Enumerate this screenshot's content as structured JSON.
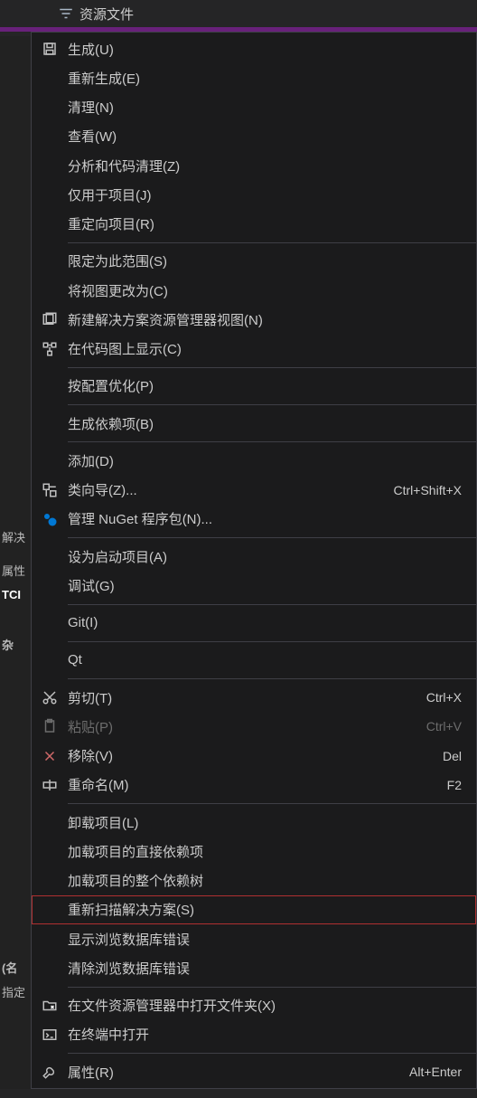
{
  "tree": {
    "item_label": "资源文件"
  },
  "leftPanel": {
    "label1": "解决",
    "label2": "属性",
    "label3": "TCI",
    "label4": "杂",
    "label5": "(名",
    "label6": "指定"
  },
  "menu": [
    {
      "type": "item",
      "icon": "save-icon",
      "label": "生成(U)"
    },
    {
      "type": "item",
      "icon": null,
      "label": "重新生成(E)"
    },
    {
      "type": "item",
      "icon": null,
      "label": "清理(N)"
    },
    {
      "type": "item",
      "icon": null,
      "label": "查看(W)"
    },
    {
      "type": "item",
      "icon": null,
      "label": "分析和代码清理(Z)"
    },
    {
      "type": "item",
      "icon": null,
      "label": "仅用于项目(J)"
    },
    {
      "type": "item",
      "icon": null,
      "label": "重定向项目(R)"
    },
    {
      "type": "sep"
    },
    {
      "type": "item",
      "icon": null,
      "label": "限定为此范围(S)"
    },
    {
      "type": "item",
      "icon": null,
      "label": "将视图更改为(C)"
    },
    {
      "type": "item",
      "icon": "new-view-icon",
      "label": "新建解决方案资源管理器视图(N)"
    },
    {
      "type": "item",
      "icon": "codemap-icon",
      "label": "在代码图上显示(C)"
    },
    {
      "type": "sep"
    },
    {
      "type": "item",
      "icon": null,
      "label": "按配置优化(P)"
    },
    {
      "type": "sep"
    },
    {
      "type": "item",
      "icon": null,
      "label": "生成依赖项(B)"
    },
    {
      "type": "sep"
    },
    {
      "type": "item",
      "icon": null,
      "label": "添加(D)"
    },
    {
      "type": "item",
      "icon": "class-wizard-icon",
      "label": "类向导(Z)...",
      "shortcut": "Ctrl+Shift+X"
    },
    {
      "type": "item",
      "icon": "nuget-icon",
      "label": "管理 NuGet 程序包(N)..."
    },
    {
      "type": "sep"
    },
    {
      "type": "item",
      "icon": null,
      "label": "设为启动项目(A)"
    },
    {
      "type": "item",
      "icon": null,
      "label": "调试(G)"
    },
    {
      "type": "sep"
    },
    {
      "type": "item",
      "icon": null,
      "label": "Git(I)"
    },
    {
      "type": "sep"
    },
    {
      "type": "item",
      "icon": null,
      "label": "Qt"
    },
    {
      "type": "sep"
    },
    {
      "type": "item",
      "icon": "cut-icon",
      "label": "剪切(T)",
      "shortcut": "Ctrl+X"
    },
    {
      "type": "item",
      "icon": "paste-icon",
      "label": "粘贴(P)",
      "shortcut": "Ctrl+V",
      "disabled": true
    },
    {
      "type": "item",
      "icon": "delete-icon",
      "label": "移除(V)",
      "shortcut": "Del"
    },
    {
      "type": "item",
      "icon": "rename-icon",
      "label": "重命名(M)",
      "shortcut": "F2"
    },
    {
      "type": "sep"
    },
    {
      "type": "item",
      "icon": null,
      "label": "卸载项目(L)"
    },
    {
      "type": "item",
      "icon": null,
      "label": "加载项目的直接依赖项"
    },
    {
      "type": "item",
      "icon": null,
      "label": "加载项目的整个依赖树"
    },
    {
      "type": "item",
      "icon": null,
      "label": "重新扫描解决方案(S)",
      "highlighted": true
    },
    {
      "type": "item",
      "icon": null,
      "label": "显示浏览数据库错误"
    },
    {
      "type": "item",
      "icon": null,
      "label": "清除浏览数据库错误"
    },
    {
      "type": "sep"
    },
    {
      "type": "item",
      "icon": "open-folder-icon",
      "label": "在文件资源管理器中打开文件夹(X)"
    },
    {
      "type": "item",
      "icon": "terminal-icon",
      "label": "在终端中打开"
    },
    {
      "type": "sep"
    },
    {
      "type": "item",
      "icon": "wrench-icon",
      "label": "属性(R)",
      "shortcut": "Alt+Enter"
    }
  ]
}
